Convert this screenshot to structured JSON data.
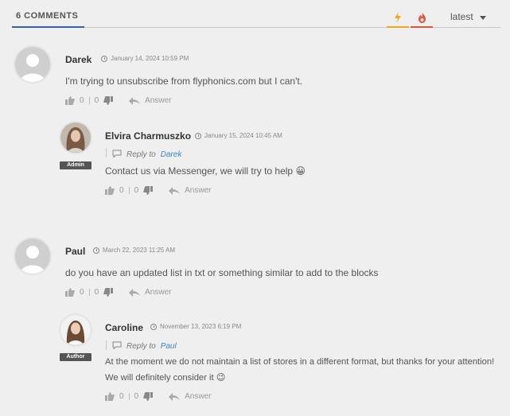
{
  "header": {
    "count_label": "6 COMMENTS",
    "sort_label": "latest",
    "colors": {
      "accent": "#3b5ea8",
      "bolt": "#f5a623",
      "fire": "#e5533c"
    },
    "icons": [
      "bolt-icon",
      "fire-icon",
      "chevron-down-icon"
    ]
  },
  "comments": [
    {
      "author": "Darek",
      "date": "January 14, 2024 10:59 PM",
      "text": "I'm trying to unsubscribe from flyphonics.com but I can't.",
      "likes": "0",
      "dislikes": "0",
      "answer": "Answer",
      "reply": {
        "author": "Elvira Charmuszko",
        "badge": "Admin",
        "date": "January 15, 2024 10:45 AM",
        "reply_to_label": "Reply to",
        "reply_to": "Darek",
        "text": "Contact us via Messenger, we will try to help 😀",
        "likes": "0",
        "dislikes": "0",
        "answer": "Answer"
      }
    },
    {
      "author": "Paul",
      "date": "March 22, 2023 11:25 AM",
      "text": "do you have an updated list in txt or something similar to add to the blocks",
      "likes": "0",
      "dislikes": "0",
      "answer": "Answer",
      "reply": {
        "author": "Caroline",
        "badge": "Author",
        "date": "November 13, 2023 6:19 PM",
        "reply_to_label": "Reply to",
        "reply_to": "Paul",
        "text_line1": "At the moment we do not maintain a list of stores in a different format, but thanks for your attention!",
        "text_line2": "We will definitely consider it 😉",
        "likes": "0",
        "dislikes": "0",
        "answer": "Answer"
      }
    }
  ]
}
